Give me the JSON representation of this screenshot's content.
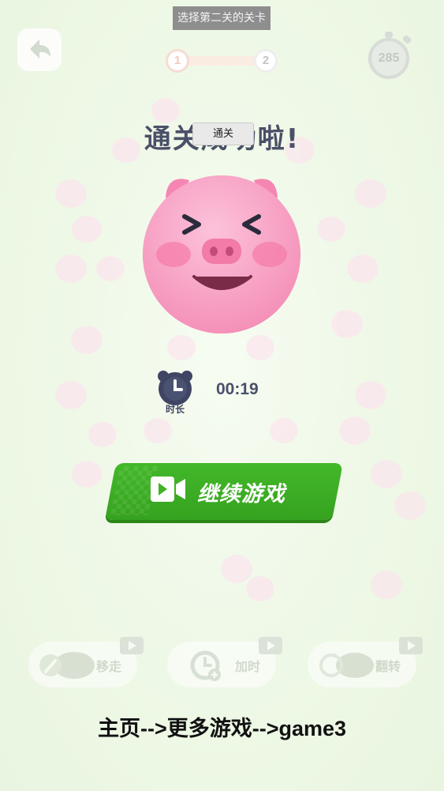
{
  "top": {
    "level_select_label": "选择第二关的关卡",
    "progress": {
      "current": "1",
      "next": "2",
      "fill_fraction": 0.0
    },
    "timer_value": "285"
  },
  "title": {
    "text": "通关成功啦!",
    "tooltip": "通关"
  },
  "stats": {
    "duration_label": "时长",
    "duration_value": "00:19"
  },
  "continue_button": {
    "label": "继续游戏",
    "icon": "video-camera-icon"
  },
  "tools": [
    {
      "label": "移走",
      "icon": "wrench-pig-icon"
    },
    {
      "label": "加时",
      "icon": "clock-plus-icon"
    },
    {
      "label": "翻转",
      "icon": "rotate-pig-icon"
    }
  ],
  "footer": {
    "text": "主页-->更多游戏-->game3"
  },
  "colors": {
    "background": "#eef8e6",
    "title": "#4a5068",
    "button_green": "#3fb226",
    "pig_pink": "#f59ac0"
  }
}
